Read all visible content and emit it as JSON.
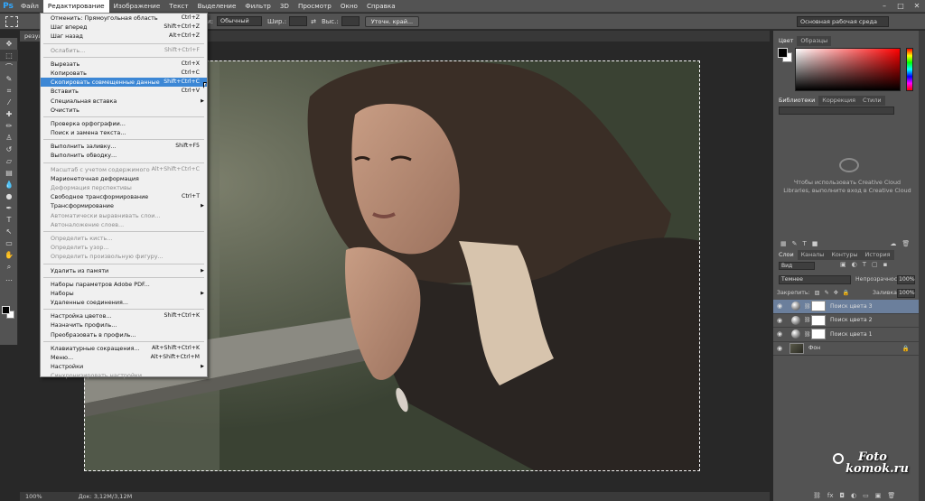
{
  "menubar": {
    "logo": "Ps",
    "items": [
      "Файл",
      "Редактирование",
      "Изображение",
      "Текст",
      "Выделение",
      "Фильтр",
      "3D",
      "Просмотр",
      "Окно",
      "Справка"
    ],
    "active_index": 1,
    "window_controls": [
      "–",
      "□",
      "✕"
    ]
  },
  "options": {
    "style_label": "тили:",
    "style_value": "Обычный",
    "width_label": "Шир.:",
    "height_label": "Выс.:",
    "refine_button": "Уточн. край...",
    "workspace": "Основная рабочая среда"
  },
  "document": {
    "tab": "резул"
  },
  "edit_menu": [
    {
      "label": "Отменить: Прямоугольная область",
      "shortcut": "Ctrl+Z"
    },
    {
      "label": "Шаг вперед",
      "shortcut": "Shift+Ctrl+Z"
    },
    {
      "label": "Шаг назад",
      "shortcut": "Alt+Ctrl+Z"
    },
    {
      "sep": true
    },
    {
      "label": "Ослабить...",
      "shortcut": "Shift+Ctrl+F",
      "disabled": true
    },
    {
      "sep": true
    },
    {
      "label": "Вырезать",
      "shortcut": "Ctrl+X"
    },
    {
      "label": "Копировать",
      "shortcut": "Ctrl+C"
    },
    {
      "label": "Скопировать совмещенные данные",
      "shortcut": "Shift+Ctrl+C",
      "highlighted": true
    },
    {
      "label": "Вставить",
      "shortcut": "Ctrl+V"
    },
    {
      "label": "Специальная вставка",
      "submenu": true
    },
    {
      "label": "Очистить"
    },
    {
      "sep": true
    },
    {
      "label": "Проверка орфографии..."
    },
    {
      "label": "Поиск и замена текста..."
    },
    {
      "sep": true
    },
    {
      "label": "Выполнить заливку...",
      "shortcut": "Shift+F5"
    },
    {
      "label": "Выполнить обводку..."
    },
    {
      "sep": true
    },
    {
      "label": "Масштаб с учетом содержимого",
      "shortcut": "Alt+Shift+Ctrl+C",
      "disabled": true
    },
    {
      "label": "Марионеточная деформация"
    },
    {
      "label": "Деформация перспективы",
      "disabled": true
    },
    {
      "label": "Свободное трансформирование",
      "shortcut": "Ctrl+T"
    },
    {
      "label": "Трансформирование",
      "submenu": true
    },
    {
      "label": "Автоматически выравнивать слои...",
      "disabled": true
    },
    {
      "label": "Автоналожение слоев...",
      "disabled": true
    },
    {
      "sep": true
    },
    {
      "label": "Определить кисть...",
      "disabled": true
    },
    {
      "label": "Определить узор...",
      "disabled": true
    },
    {
      "label": "Определить произвольную фигуру...",
      "disabled": true
    },
    {
      "sep": true
    },
    {
      "label": "Удалить из памяти",
      "submenu": true
    },
    {
      "sep": true
    },
    {
      "label": "Наборы параметров Adobe PDF..."
    },
    {
      "label": "Наборы",
      "submenu": true
    },
    {
      "label": "Удаленные соединения..."
    },
    {
      "sep": true
    },
    {
      "label": "Настройка цветов...",
      "shortcut": "Shift+Ctrl+K"
    },
    {
      "label": "Назначить профиль..."
    },
    {
      "label": "Преобразовать в профиль..."
    },
    {
      "sep": true
    },
    {
      "label": "Клавиатурные сокращения...",
      "shortcut": "Alt+Shift+Ctrl+K"
    },
    {
      "label": "Меню...",
      "shortcut": "Alt+Shift+Ctrl+M"
    },
    {
      "label": "Настройки",
      "submenu": true
    },
    {
      "label": "Синхронизировать настройки",
      "disabled": true
    }
  ],
  "color_panel": {
    "tabs": [
      "Цвет",
      "Образцы"
    ]
  },
  "libraries_panel": {
    "tabs": [
      "Библиотеки",
      "Коррекция",
      "Стили"
    ],
    "message_line1": "Чтобы использовать Creative Cloud",
    "message_line2": "Libraries, выполните вход в Creative Cloud"
  },
  "layers_panel": {
    "tabs": [
      "Слои",
      "Каналы",
      "Контуры",
      "История"
    ],
    "filter": "Вид",
    "blend_mode": "Темнее",
    "opacity_label": "Непрозрачность:",
    "opacity": "100%",
    "lock_label": "Закрепить:",
    "fill_label": "Заливка:",
    "fill": "100%",
    "layers": [
      {
        "name": "Поиск цвета 3",
        "selected": true,
        "type": "adjustment"
      },
      {
        "name": "Поиск цвета 2",
        "selected": false,
        "type": "adjustment"
      },
      {
        "name": "Поиск цвета 1",
        "selected": false,
        "type": "adjustment"
      },
      {
        "name": "Фон",
        "selected": false,
        "type": "image",
        "locked": true
      }
    ]
  },
  "status": {
    "zoom": "100%",
    "doc": "Док: 3,12M/3,12M"
  },
  "watermark": {
    "line1": "Foto",
    "line2": "komok.ru"
  },
  "colors": {
    "accent": "#3c87d5",
    "selected_layer": "#6b7f9c"
  }
}
